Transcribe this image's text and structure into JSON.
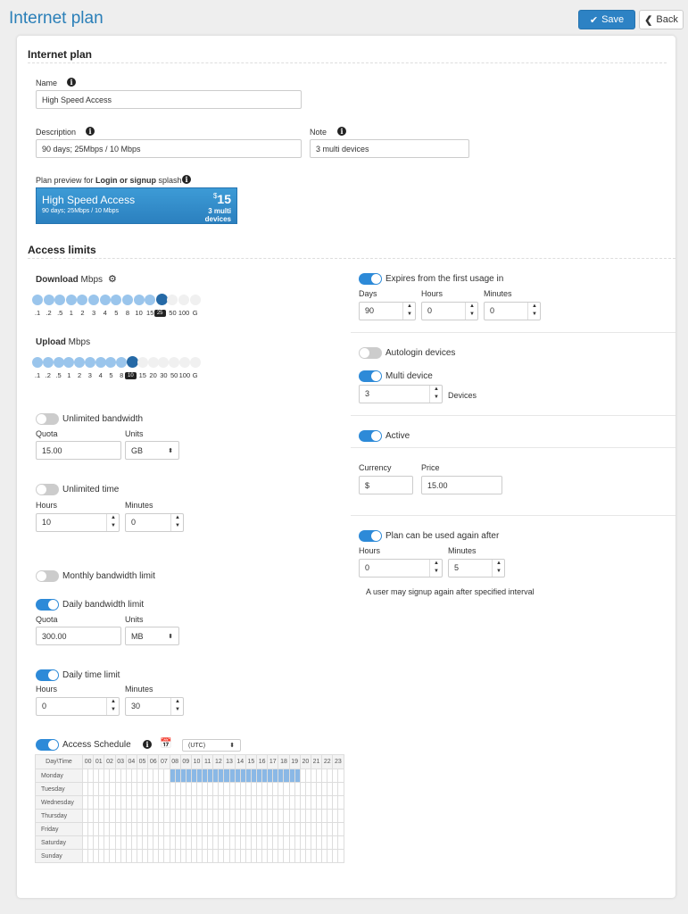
{
  "header": {
    "title": "Internet plan",
    "save_label": "Save",
    "back_label": "Back"
  },
  "plan": {
    "section_title": "Internet plan",
    "name_label": "Name",
    "name_value": "High Speed Access",
    "description_label": "Description",
    "description_value": "90 days; 25Mbps / 10 Mbps",
    "note_label": "Note",
    "note_value": "3 multi devices",
    "preview_label_prefix": "Plan preview for ",
    "preview_label_bold": "Login or signup",
    "preview_label_suffix": " splash",
    "preview": {
      "name": "High Speed Access",
      "desc": "90 days; 25Mbps / 10 Mbps",
      "currency": "$",
      "price": "15",
      "multi_line1": "3 multi",
      "multi_line2": "devices"
    }
  },
  "access": {
    "section_title": "Access limits",
    "download": {
      "label_bold": "Download",
      "label_unit": " Mbps",
      "ticks": [
        ".1",
        ".2",
        ".5",
        "1",
        "2",
        "3",
        "4",
        "5",
        "8",
        "10",
        "15",
        "25",
        "50",
        "100",
        "G"
      ],
      "value": "25",
      "selected_index": 11
    },
    "upload": {
      "label_bold": "Upload",
      "label_unit": " Mbps",
      "ticks": [
        ".1",
        ".2",
        ".5",
        "1",
        "2",
        "3",
        "4",
        "5",
        "8",
        "10",
        "15",
        "20",
        "30",
        "50",
        "100",
        "G"
      ],
      "value": "10",
      "selected_index": 9
    },
    "unlimited_bandwidth": {
      "label": "Unlimited bandwidth",
      "on": false,
      "quota_label": "Quota",
      "quota_value": "15.00",
      "units_label": "Units",
      "units_value": "GB"
    },
    "unlimited_time": {
      "label": "Unlimited time",
      "on": false,
      "hours_label": "Hours",
      "hours_value": "10",
      "minutes_label": "Minutes",
      "minutes_value": "0"
    },
    "monthly_bandwidth": {
      "label": "Monthly bandwidth limit",
      "on": false
    },
    "daily_bandwidth": {
      "label": "Daily bandwidth limit",
      "on": true,
      "quota_label": "Quota",
      "quota_value": "300.00",
      "units_label": "Units",
      "units_value": "MB"
    },
    "daily_time": {
      "label": "Daily time limit",
      "on": true,
      "hours_label": "Hours",
      "hours_value": "0",
      "minutes_label": "Minutes",
      "minutes_value": "30"
    },
    "schedule": {
      "label": "Access Schedule",
      "on": true,
      "timezone": "(UTC)",
      "corner": "Day\\Time",
      "hours": [
        "00",
        "01",
        "02",
        "03",
        "04",
        "05",
        "06",
        "07",
        "08",
        "09",
        "10",
        "11",
        "12",
        "13",
        "14",
        "15",
        "16",
        "17",
        "18",
        "19",
        "20",
        "21",
        "22",
        "23"
      ],
      "days": [
        "Monday",
        "Tuesday",
        "Wednesday",
        "Thursday",
        "Friday",
        "Saturday",
        "Sunday"
      ],
      "selected": [
        {
          "day": "Monday",
          "from": 8,
          "to": 20
        }
      ]
    },
    "expires": {
      "label": "Expires from the first usage in",
      "on": true,
      "days_label": "Days",
      "days_value": "90",
      "hours_label": "Hours",
      "hours_value": "0",
      "minutes_label": "Minutes",
      "minutes_value": "0"
    },
    "autologin": {
      "label": "Autologin devices",
      "on": false
    },
    "multi_device": {
      "label": "Multi device",
      "on": true,
      "value": "3",
      "suffix": "Devices"
    },
    "active": {
      "label": "Active",
      "on": true
    },
    "currency_label": "Currency",
    "currency_value": "$",
    "price_label": "Price",
    "price_value": "15.00",
    "reuse": {
      "label": "Plan can be used again after",
      "on": true,
      "hours_label": "Hours",
      "hours_value": "0",
      "minutes_label": "Minutes",
      "minutes_value": "5",
      "note": "A user may signup again after specified interval"
    }
  },
  "colors": {
    "accent": "#2d8ad8",
    "title": "#2a7fb8",
    "slider_fill": "#9ac5ec",
    "slider_handle": "#2569a6",
    "schedule_fill": "#8ab8e6"
  }
}
